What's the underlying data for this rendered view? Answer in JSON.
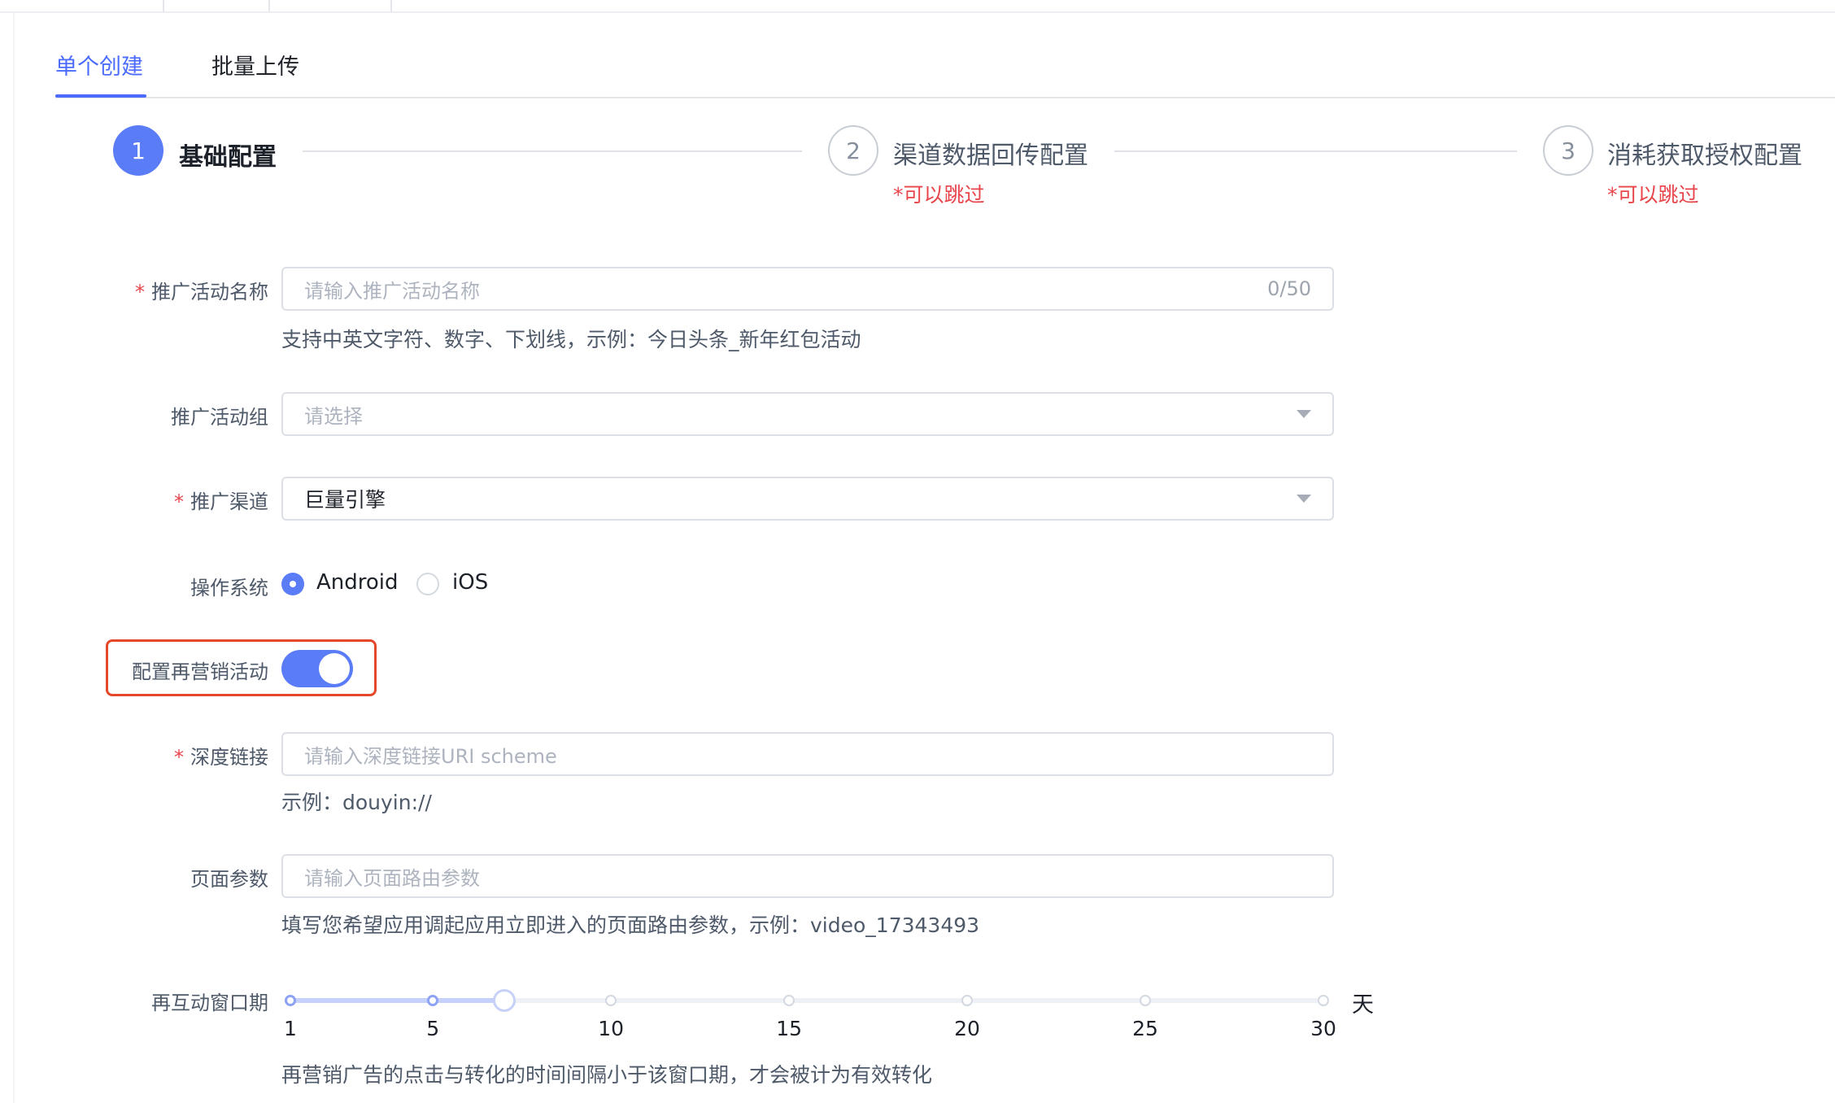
{
  "tabs": [
    {
      "label": "单个创建",
      "active": true
    },
    {
      "label": "批量上传",
      "active": false
    }
  ],
  "steps": [
    {
      "number": "1",
      "title": "基础配置",
      "note": "",
      "active": true
    },
    {
      "number": "2",
      "title": "渠道数据回传配置",
      "note": "*可以跳过",
      "active": false
    },
    {
      "number": "3",
      "title": "消耗获取授权配置",
      "note": "*可以跳过",
      "active": false
    }
  ],
  "form": {
    "campaign_name": {
      "label": "推广活动名称",
      "required": true,
      "placeholder": "请输入推广活动名称",
      "counter": "0/50",
      "hint": "支持中英文字符、数字、下划线，示例：今日头条_新年红包活动"
    },
    "campaign_group": {
      "label": "推广活动组",
      "required": false,
      "placeholder": "请选择"
    },
    "channel": {
      "label": "推广渠道",
      "required": true,
      "value": "巨量引擎"
    },
    "os": {
      "label": "操作系统",
      "options": [
        "Android",
        "iOS"
      ],
      "selected": "Android"
    },
    "remarketing": {
      "label": "配置再营销活动",
      "enabled": true
    },
    "deep_link": {
      "label": "深度链接",
      "required": true,
      "placeholder": "请输入深度链接URI scheme",
      "hint": "示例：douyin://"
    },
    "page_params": {
      "label": "页面参数",
      "required": false,
      "placeholder": "请输入页面路由参数",
      "hint": "填写您希望应用调起应用立即进入的页面路由参数，示例：video_17343493"
    },
    "window": {
      "label": "再互动窗口期",
      "unit": "天",
      "min": 1,
      "max": 30,
      "value": 7,
      "marks": [
        "1",
        "5",
        "10",
        "15",
        "20",
        "25",
        "30"
      ],
      "hint": "再营销广告的点击与转化的时间间隔小于该窗口期，才会被计为有效转化"
    }
  },
  "colors": {
    "primary": "#5b7cf7",
    "required": "#e8454b",
    "highlight": "#e5472b"
  }
}
